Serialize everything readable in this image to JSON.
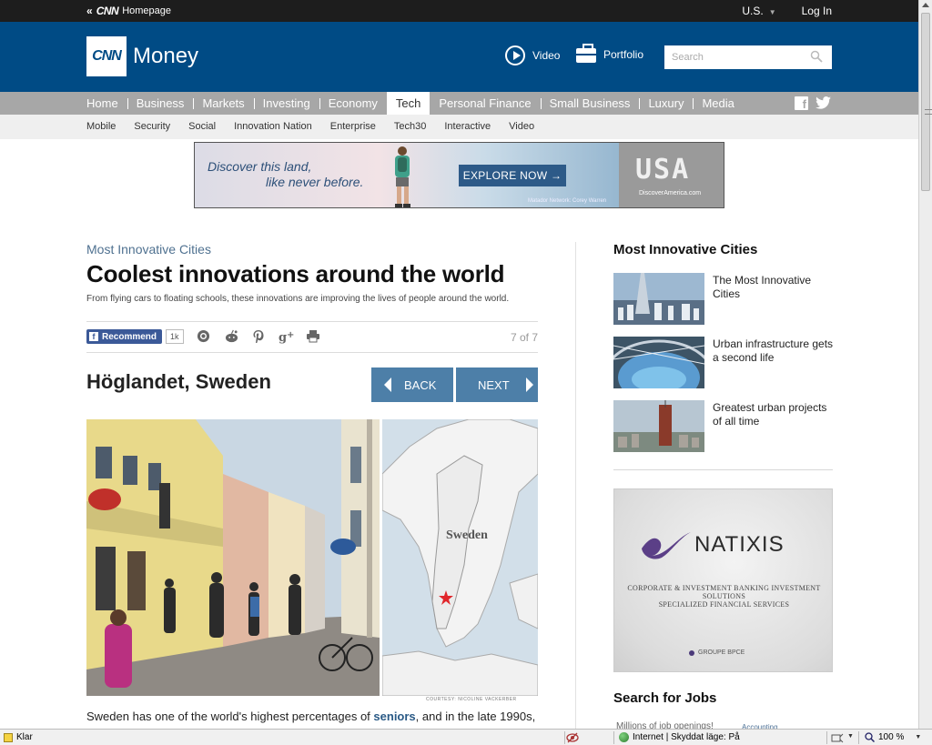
{
  "topbar": {
    "back_label": "Homepage",
    "cnn_mark": "CNN",
    "region": "U.S.",
    "login": "Log In"
  },
  "header": {
    "logo_mark": "CNN",
    "logo_text": "Money",
    "video_label": "Video",
    "portfolio_label": "Portfolio",
    "search_placeholder": "Search",
    "brand_color": "#004b85"
  },
  "nav_primary": {
    "items": [
      "Home",
      "Business",
      "Markets",
      "Investing",
      "Economy",
      "Tech",
      "Personal Finance",
      "Small Business",
      "Luxury",
      "Media"
    ],
    "active": "Tech"
  },
  "nav_secondary": {
    "items": [
      "Mobile",
      "Security",
      "Social",
      "Innovation Nation",
      "Enterprise",
      "Tech30",
      "Interactive",
      "Video"
    ]
  },
  "banner_ad": {
    "line1": "Discover this land,",
    "line2": "like never before.",
    "cta": "EXPLORE NOW →",
    "credit": "Matador Network: Corey Warren",
    "logo": "USA",
    "site": "DiscoverAmerica.com"
  },
  "article": {
    "kicker": "Most Innovative Cities",
    "headline": "Coolest innovations around the world",
    "deck": "From flying cars to floating schools, these innovations are improving the lives of people around the world.",
    "recommend_label": "Recommend",
    "recommend_count": "1k",
    "pager": "7 of 7",
    "slide_title": "Höglandet, Sweden",
    "back_label": "BACK",
    "next_label": "NEXT",
    "map_label": "Sweden",
    "courtesy": "COURTESY: NICOLINE VACKERBER",
    "body_pre": "Sweden has one of the world's highest percentages of ",
    "body_link": "seniors",
    "body_post": ", and in the late 1990s,"
  },
  "sidebar": {
    "title": "Most Innovative Cities",
    "items": [
      {
        "caption": "The Most Innovative Cities"
      },
      {
        "caption": "Urban infrastructure gets a second life"
      },
      {
        "caption": "Greatest urban projects of all time"
      }
    ],
    "ad": {
      "brand": "NATIXIS",
      "line1": "CORPORATE & INVESTMENT BANKING     INVESTMENT SOLUTIONS",
      "line2": "SPECIALIZED FINANCIAL SERVICES",
      "group": "GROUPE BPCE"
    },
    "jobs_title": "Search for Jobs",
    "jobs_sub": "Millions of job openings!",
    "jobs_sub2": "Accounting"
  },
  "statusbar": {
    "status": "Klar",
    "zone": "Internet | Skyddat läge: På",
    "zoom": "100 %"
  }
}
